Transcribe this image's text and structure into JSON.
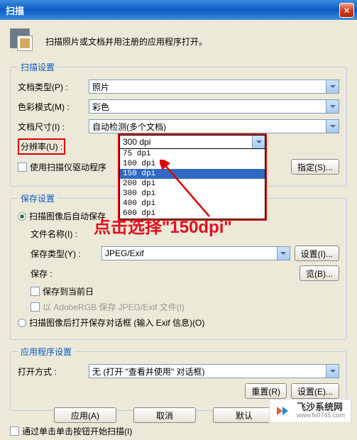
{
  "window": {
    "title": "扫描",
    "close": "×"
  },
  "header": {
    "text": "扫描照片或文档并用注册的应用程序打开。"
  },
  "scan_settings": {
    "legend": "扫描设置",
    "doc_type_label": "文档类型(P) :",
    "doc_type_value": "照片",
    "color_mode_label": "色彩模式(M) :",
    "color_mode_value": "彩色",
    "doc_size_label": "文档尺寸(I) :",
    "doc_size_value": "自动检测(多个文档)",
    "resolution_label": "分辨率(U) :",
    "resolution_value": "300 dpi",
    "use_driver_label": "使用扫描仪驱动程序",
    "specify_btn": "指定(S)..."
  },
  "dropdown": {
    "current": "300 dpi",
    "items": [
      "75 dpi",
      "100 dpi",
      "150 dpi",
      "200 dpi",
      "300 dpi",
      "400 dpi",
      "600 dpi"
    ],
    "selected_index": 2
  },
  "save_settings": {
    "legend": "保存设置",
    "auto_save_label": "扫描图像后自动保存",
    "file_name_label": "文件名称(I) :",
    "save_type_label": "保存类型(Y) :",
    "save_type_value": "JPEG/Exif",
    "set_btn": "设置(I)...",
    "save_to_label": "保存 :",
    "browse_btn": "  览(B)...",
    "save_today_label": "保存到当前日",
    "adobe_rgb_label": "以 AdobeRGB 保存 JPEG/Exif 文件(I)",
    "open_dialog_label": "扫描图像后打开保存对话框 (输入 Exif 信息)(O)"
  },
  "app_settings": {
    "legend": "应用程序设置",
    "open_with_label": "打开方式 :",
    "open_with_value": "无 (打开 \"查看并使用\" 对话框)",
    "reset_btn": "重置(R)",
    "set_btn": "设置(E)..."
  },
  "bottom": {
    "single_click_label": "通过单击单击按钮开始扫描(I)",
    "apply_btn": "应用(A)",
    "cancel_btn": "取消",
    "default_btn": "默认"
  },
  "annotation": {
    "text": "点击选择\"150dpi\""
  },
  "watermark": {
    "line1": "飞沙系统网",
    "line2": "www.fs0745.com"
  }
}
